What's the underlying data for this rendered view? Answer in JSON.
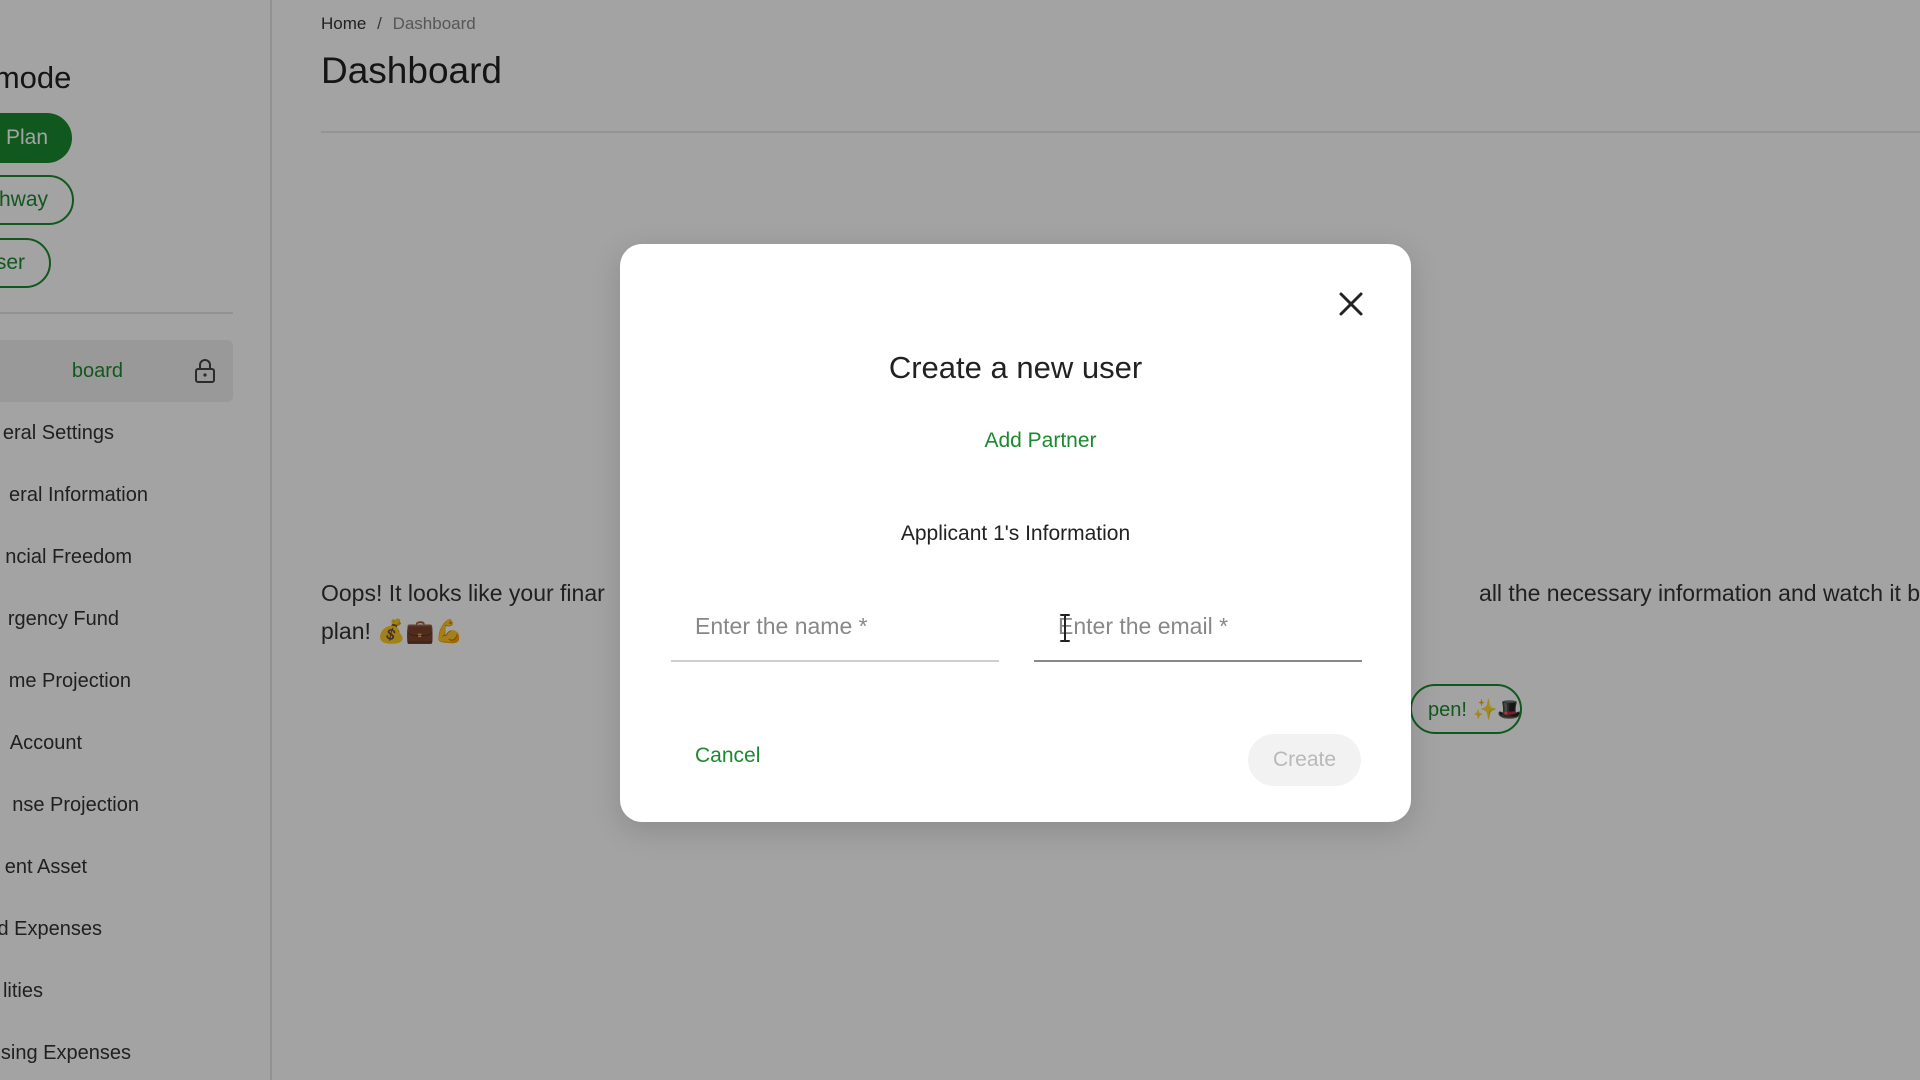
{
  "sidebar": {
    "mode_title": "n mode",
    "pills": {
      "plan": "Plan",
      "pathway": "hway",
      "user": "ser"
    },
    "nav_items": [
      "board",
      "eral Settings",
      "eral Information",
      "ncial Freedom",
      "rgency Fund",
      "me Projection",
      "Account",
      "nse Projection",
      "ent Asset",
      "d Expenses",
      "lities",
      "sing Expenses"
    ],
    "icons": {
      "lock": "lock-icon"
    }
  },
  "main": {
    "breadcrumb": {
      "home": "Home",
      "separator": "/",
      "current": "Dashboard"
    },
    "title": "Dashboard",
    "oops_left": "Oops! It looks like your finar",
    "oops_right": "all the necessary information and watch it bloss",
    "oops_line2": "plan! 💰💼💪",
    "cta_text": "pen! ✨🎩"
  },
  "modal": {
    "title": "Create a new user",
    "add_partner": "Add Partner",
    "section_label": "Applicant 1's Information",
    "name_placeholder": "Enter the name *",
    "email_placeholder": "Enter the email *",
    "cancel": "Cancel",
    "create": "Create",
    "icons": {
      "close": "close-icon",
      "cursor": "text-cursor-icon"
    }
  },
  "colors": {
    "accent": "#1b8a2f",
    "overlay": "rgba(0,0,0,0.36)",
    "disabled_bg": "#f2f2f2",
    "disabled_text": "#b9b9b9"
  }
}
